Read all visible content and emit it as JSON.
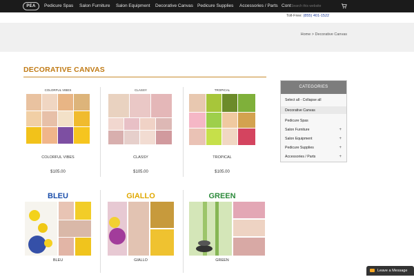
{
  "nav": {
    "logo": "PEA",
    "items": [
      "Pedicure Spas",
      "Salon Furniture",
      "Salon Equipment",
      "Decorative Canvas",
      "Pedicure Supplies",
      "Accessories / Parts",
      "Contact"
    ],
    "search_placeholder": "Search this website",
    "cart_icon": "cart-icon"
  },
  "contact": {
    "phone": "(855) 401-1522",
    "prefix": "Toll-Free: "
  },
  "breadcrumb": "Home > Decorative Canvas",
  "page_title": "DECORATIVE CANVAS",
  "products": [
    {
      "name": "COLORFUL VIBES",
      "price": "$105.00",
      "canvas_title": "COLORFUL VIBES"
    },
    {
      "name": "CLASSY",
      "price": "$105.00",
      "canvas_title": "CLASSY"
    },
    {
      "name": "TROPICAL",
      "price": "$105.00",
      "canvas_title": "TROPICAL"
    },
    {
      "name": "BLEU",
      "price": "",
      "canvas_title": "BLEU"
    },
    {
      "name": "GIALLO",
      "price": "",
      "canvas_title": "GIALLO"
    },
    {
      "name": "GREEN",
      "price": "",
      "canvas_title": "GREEN"
    }
  ],
  "sidebar": {
    "heading": "CATEGORIES",
    "select_label": "Select all  -  Collapse all",
    "items": [
      {
        "label": "Decorative Canvas",
        "plus": false
      },
      {
        "label": "Pedicure Spas",
        "plus": false
      },
      {
        "label": "Salon Furniture",
        "plus": true
      },
      {
        "label": "Salon Equipment",
        "plus": true
      },
      {
        "label": "Pedicure Supplies",
        "plus": true
      },
      {
        "label": "Accessories / Parts",
        "plus": true
      }
    ]
  },
  "leave_message": "Leave a Message",
  "colors": {
    "accent": "#c07a14",
    "bleu": "#1b4eaa",
    "giallo": "#e0a800",
    "green": "#2b8a3a"
  }
}
